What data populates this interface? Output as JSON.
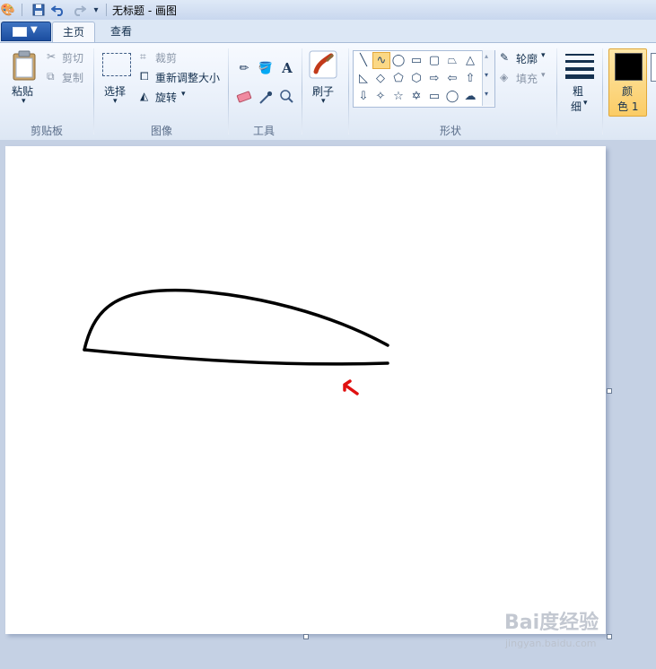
{
  "window": {
    "title": "无标题 - 画图"
  },
  "tabs": [
    {
      "label": "主页",
      "active": true
    },
    {
      "label": "查看",
      "active": false
    }
  ],
  "ribbon": {
    "clipboard": {
      "group_label": "剪贴板",
      "paste": "粘贴",
      "cut": "剪切",
      "copy": "复制"
    },
    "image": {
      "group_label": "图像",
      "select": "选择",
      "crop": "裁剪",
      "resize": "重新调整大小",
      "rotate": "旋转"
    },
    "tools": {
      "group_label": "工具"
    },
    "brush": {
      "label": "刷子"
    },
    "shapes": {
      "group_label": "形状",
      "outline": "轮廓",
      "fill": "填充"
    },
    "size": {
      "label_1": "粗",
      "label_2": "细"
    },
    "color1": {
      "label_1": "颜",
      "label_2": "色 1",
      "value": "#000000"
    }
  },
  "accent": {
    "selected_shape": "#fbd885",
    "arrow": "#e01010"
  },
  "watermark": {
    "logo": "Bai度经验",
    "url": "jingyan.baidu.com"
  }
}
